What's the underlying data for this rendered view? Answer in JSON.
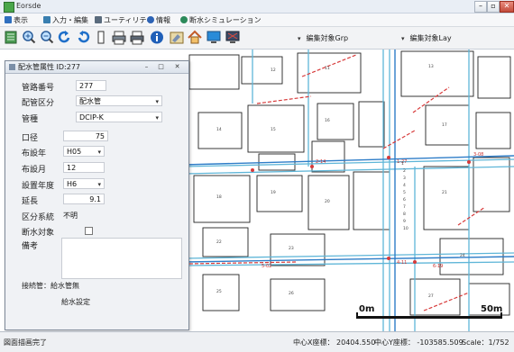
{
  "window": {
    "title": "Eorsde"
  },
  "menu": {
    "items": [
      {
        "label": "表示",
        "icon": "view-icon",
        "color": "#2f6fbf"
      },
      {
        "label": "入力・編集",
        "icon": "edit-icon",
        "color": "#3a7fb0"
      },
      {
        "label": "ユーティリティ",
        "icon": "utility-icon",
        "color": "#5a6b7d"
      },
      {
        "label": "情報",
        "icon": "info-icon",
        "color": "#2d63b5"
      },
      {
        "label": "断水シミュレーション",
        "icon": "simulation-icon",
        "color": "#2c8a5a"
      }
    ]
  },
  "toolbar": {
    "select_a": "編集対象Grp",
    "select_b": "編集対象Lay"
  },
  "dialog": {
    "title": "配水管属性 ID:277",
    "fields": [
      {
        "label": "管路番号",
        "value": "277"
      },
      {
        "label": "配管区分",
        "value": "配水管"
      },
      {
        "label": "管種",
        "value": "DCIP-K"
      },
      {
        "label": "口径",
        "value": "75"
      },
      {
        "label": "布設年",
        "value": "H05"
      },
      {
        "label": "布設月",
        "value": "12"
      },
      {
        "label": "設置年度",
        "value": "H6"
      },
      {
        "label": "延長",
        "value": "9.1"
      },
      {
        "label": "区分系統",
        "value": "不明"
      },
      {
        "label": "断水対象",
        "value": ""
      },
      {
        "label": "備考",
        "value": ""
      }
    ],
    "footer_label": "接続管：給水管無",
    "footer_sub": "給水設定"
  },
  "map": {
    "scale_label": "0m",
    "scale_label_end": "50m"
  },
  "status": {
    "left": "図面描画完了",
    "coord_x": "中心X座標：  20404.550",
    "coord_y": "中心Y座標：  -103585.509",
    "scale": "Scale：1/752"
  },
  "colors": {
    "pipe_main": "#5fb6d8",
    "pipe_red": "#d73a3a",
    "road_blue": "#2e7dc8",
    "panel_bg": "#f0f2f5"
  }
}
